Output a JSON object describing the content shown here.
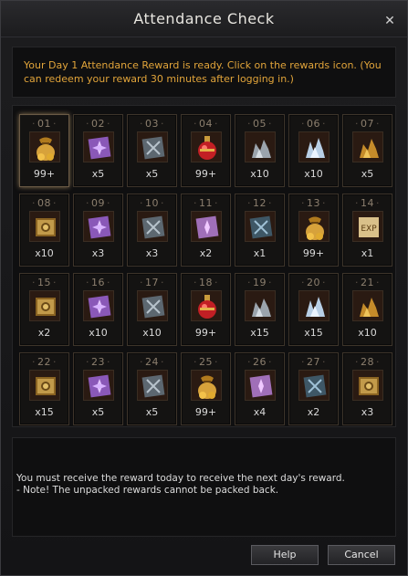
{
  "window": {
    "title": "Attendance Check"
  },
  "notice": "Your Day 1 Attendance Reward is ready. Click on the rewards icon. (You can redeem your reward 30 minutes after logging in.)",
  "days": [
    {
      "day": "01",
      "qty": "99+",
      "item": "gold-pouch"
    },
    {
      "day": "02",
      "qty": "x5",
      "item": "purple-scroll"
    },
    {
      "day": "03",
      "qty": "x5",
      "item": "gray-scroll"
    },
    {
      "day": "04",
      "qty": "99+",
      "item": "red-potion"
    },
    {
      "day": "05",
      "qty": "x10",
      "item": "silver-ore"
    },
    {
      "day": "06",
      "qty": "x10",
      "item": "crystal-ore"
    },
    {
      "day": "07",
      "qty": "x5",
      "item": "gold-ore"
    },
    {
      "day": "08",
      "qty": "x10",
      "item": "gold-chest"
    },
    {
      "day": "09",
      "qty": "x3",
      "item": "purple-scroll"
    },
    {
      "day": "10",
      "qty": "x3",
      "item": "gray-scroll"
    },
    {
      "day": "11",
      "qty": "x2",
      "item": "pink-scroll"
    },
    {
      "day": "12",
      "qty": "x1",
      "item": "blue-scroll"
    },
    {
      "day": "13",
      "qty": "99+",
      "item": "gold-pouch"
    },
    {
      "day": "14",
      "qty": "x1",
      "item": "exp-card"
    },
    {
      "day": "15",
      "qty": "x2",
      "item": "gold-chest"
    },
    {
      "day": "16",
      "qty": "x10",
      "item": "purple-scroll"
    },
    {
      "day": "17",
      "qty": "x10",
      "item": "gray-scroll"
    },
    {
      "day": "18",
      "qty": "99+",
      "item": "red-potion"
    },
    {
      "day": "19",
      "qty": "x15",
      "item": "silver-ore"
    },
    {
      "day": "20",
      "qty": "x15",
      "item": "crystal-ore"
    },
    {
      "day": "21",
      "qty": "x10",
      "item": "gold-ore"
    },
    {
      "day": "22",
      "qty": "x15",
      "item": "gold-chest"
    },
    {
      "day": "23",
      "qty": "x5",
      "item": "purple-scroll"
    },
    {
      "day": "24",
      "qty": "x5",
      "item": "gray-scroll"
    },
    {
      "day": "25",
      "qty": "99+",
      "item": "gold-pouch"
    },
    {
      "day": "26",
      "qty": "x4",
      "item": "pink-scroll"
    },
    {
      "day": "27",
      "qty": "x2",
      "item": "blue-scroll"
    },
    {
      "day": "28",
      "qty": "x3",
      "item": "gold-chest"
    }
  ],
  "info": {
    "line1": "You must receive the reward today to receive the next day's reward.",
    "line2": "- Note! The unpacked rewards cannot be packed back."
  },
  "buttons": {
    "help": "Help",
    "cancel": "Cancel"
  },
  "colors": {
    "notice": "#e1a43a",
    "panel_bg": "#0f0f10",
    "cell_border": "#3d342a"
  }
}
